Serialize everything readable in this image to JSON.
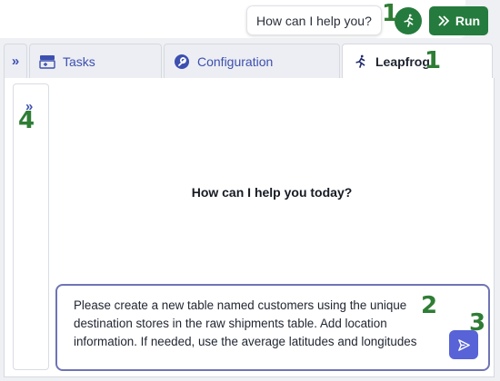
{
  "header": {
    "help_bubble": "How can I help you?",
    "run_label": "Run"
  },
  "tabs": [
    {
      "label": "Tasks",
      "icon": "tasks-table-icon"
    },
    {
      "label": "Configuration",
      "icon": "wrench-icon"
    },
    {
      "label": "Leapfrog",
      "icon": "leapfrog-runner-icon",
      "active": true
    }
  ],
  "main": {
    "greeting": "How can I help you today?",
    "prompt_text": "Please create a new table named customers using the unique destination stores in the raw shipments table. Add location information. If needed, use the average latitudes and longitudes"
  },
  "annotations": [
    "1",
    "1",
    "2",
    "3",
    "4"
  ],
  "colors": {
    "brand_green": "#247b3d",
    "tab_text": "#3d4fb0",
    "send_button": "#5763d6",
    "composer_border": "#6f74b5",
    "annotation": "#2f7d35"
  }
}
